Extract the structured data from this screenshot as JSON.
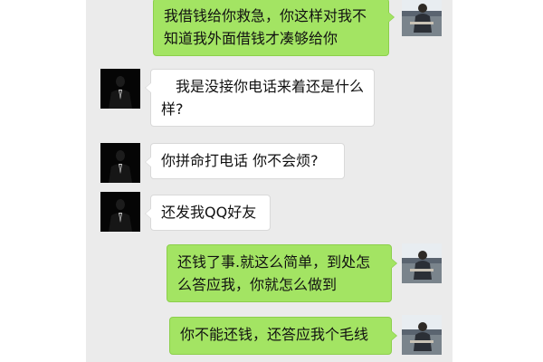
{
  "chat": {
    "messages": [
      {
        "sender": "self",
        "avatar_icon": "user-photo-avatar",
        "text": "我借钱给你救急，你这样对我不知道我外面借钱才凑够给你"
      },
      {
        "sender": "other",
        "avatar_icon": "dark-suit-avatar",
        "text": "　我是没接你电话来着还是什么样?"
      },
      {
        "sender": "other",
        "avatar_icon": "dark-suit-avatar",
        "text": "你拼命打电话 你不会烦?"
      },
      {
        "sender": "other",
        "avatar_icon": "dark-suit-avatar",
        "text": "还发我QQ好友"
      },
      {
        "sender": "self",
        "avatar_icon": "user-photo-avatar",
        "text": "还钱了事.就这么简单，到处怎么答应我，你就怎么做到"
      },
      {
        "sender": "self",
        "avatar_icon": "user-photo-avatar",
        "text": "你不能还钱，还答应我个毛线"
      }
    ]
  },
  "colors": {
    "chat_background": "#ebebeb",
    "outgoing_bubble": "#a3e463",
    "incoming_bubble": "#ffffff"
  }
}
